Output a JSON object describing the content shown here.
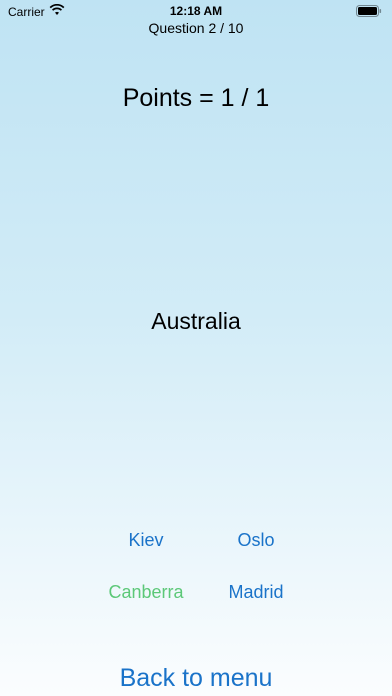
{
  "status_bar": {
    "carrier": "Carrier",
    "time": "12:18 AM",
    "icons": [
      "wifi-icon",
      "battery-icon"
    ]
  },
  "quiz": {
    "question_counter": "Question 2 / 10",
    "points": "Points = 1 / 1",
    "country": "Australia",
    "answers": [
      {
        "label": "Kiev",
        "state": "default"
      },
      {
        "label": "Oslo",
        "state": "default"
      },
      {
        "label": "Canberra",
        "state": "correct"
      },
      {
        "label": "Madrid",
        "state": "default"
      }
    ]
  },
  "navigation": {
    "back_label": "Back to menu"
  },
  "colors": {
    "accent": "#1a73c9",
    "correct": "#5cc878",
    "gradient_top": "#bfe3f3",
    "gradient_bottom": "#fbfdfe"
  }
}
